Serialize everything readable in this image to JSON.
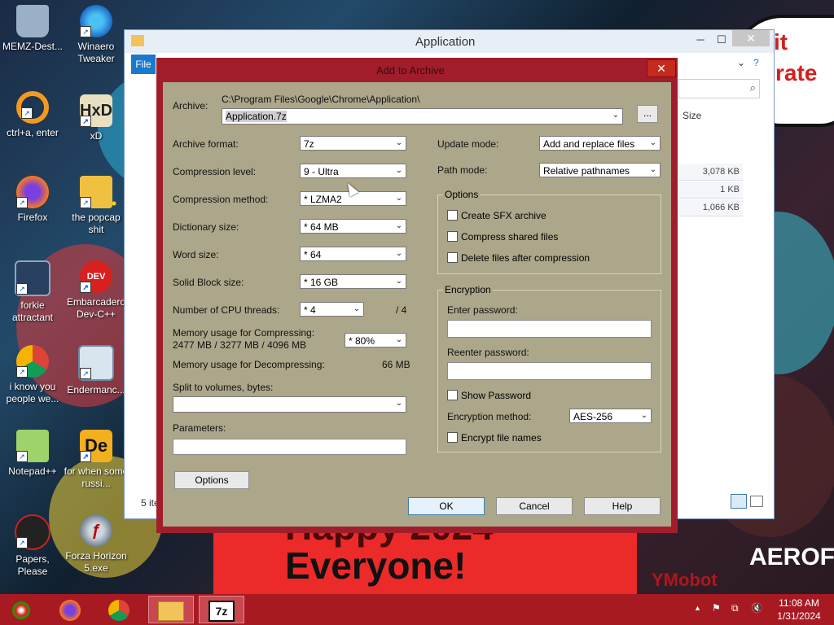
{
  "desktop": {
    "icons": [
      {
        "label": "MEMZ-Dest...",
        "icon": "recycle-bin-icon"
      },
      {
        "label": "Winaero Tweaker",
        "icon": "winaero-tweaker-icon"
      },
      {
        "label": "ctrl+a, enter",
        "icon": "orange-ring-icon"
      },
      {
        "label": "xD",
        "icon": "hxd-icon"
      },
      {
        "label": "Firefox",
        "icon": "firefox-icon"
      },
      {
        "label": "the popcap shit",
        "icon": "popcap-icon"
      },
      {
        "label": "forkie attractant",
        "icon": "monitor-gear-icon"
      },
      {
        "label": "Embarcadero Dev-C++",
        "icon": "devcpp-icon"
      },
      {
        "label": "i know you people we...",
        "icon": "chrome-icon"
      },
      {
        "label": "Endermanc...",
        "icon": "window-app-icon"
      },
      {
        "label": "Notepad++",
        "icon": "notepadpp-icon"
      },
      {
        "label": "for when some russi...",
        "icon": "de-icon"
      },
      {
        "label": "Papers, Please",
        "icon": "papers-please-icon"
      },
      {
        "label": "Forza Horizon 5.exe",
        "icon": "flash-icon"
      }
    ],
    "wallpaper_text": {
      "speech_line1": "it",
      "speech_line2": "rate",
      "banner_top": "Happy 2024",
      "banner": "Everyone!",
      "sign": "AEROFOS",
      "watermark": "YMobot"
    }
  },
  "explorer": {
    "title": "Application",
    "ribbon_file": "File",
    "column_size": "Size",
    "sizes": [
      "3,078 KB",
      "1 KB",
      "1,066 KB"
    ],
    "status_items": "5 ite",
    "search_icon": "search-icon"
  },
  "dialog": {
    "title": "Add to Archive",
    "archive_label": "Archive:",
    "archive_path": "C:\\Program Files\\Google\\Chrome\\Application\\",
    "archive_name": "Application.7z",
    "browse_label": "...",
    "left": {
      "archive_format_label": "Archive format:",
      "archive_format": "7z",
      "compression_level_label": "Compression level:",
      "compression_level": "9 - Ultra",
      "compression_method_label": "Compression method:",
      "compression_method": "* LZMA2",
      "dictionary_size_label": "Dictionary size:",
      "dictionary_size": "* 64 MB",
      "word_size_label": "Word size:",
      "word_size": "* 64",
      "solid_block_label": "Solid Block size:",
      "solid_block": "* 16 GB",
      "cpu_threads_label": "Number of CPU threads:",
      "cpu_threads": "* 4",
      "cpu_threads_max": "/ 4",
      "mem_compress_label": "Memory usage for Compressing:",
      "mem_compress_value": "2477 MB / 3277 MB / 4096 MB",
      "mem_compress_pct": "* 80%",
      "mem_decompress_label": "Memory usage for Decompressing:",
      "mem_decompress_value": "66 MB",
      "split_label": "Split to volumes, bytes:",
      "split_value": "",
      "parameters_label": "Parameters:",
      "parameters_value": "",
      "options_button": "Options"
    },
    "right": {
      "update_mode_label": "Update mode:",
      "update_mode": "Add and replace files",
      "path_mode_label": "Path mode:",
      "path_mode": "Relative pathnames",
      "options_group": "Options",
      "create_sfx": "Create SFX archive",
      "compress_shared": "Compress shared files",
      "delete_after": "Delete files after compression",
      "encryption_group": "Encryption",
      "enter_password_label": "Enter password:",
      "reenter_password_label": "Reenter password:",
      "show_password": "Show Password",
      "encryption_method_label": "Encryption method:",
      "encryption_method": "AES-256",
      "encrypt_names": "Encrypt file names"
    },
    "buttons": {
      "ok": "OK",
      "cancel": "Cancel",
      "help": "Help"
    }
  },
  "taskbar": {
    "pinned": [
      "firefox-icon",
      "chrome-icon",
      "file-explorer-icon",
      "7zip-icon"
    ],
    "time": "11:08 AM",
    "date": "1/31/2024"
  }
}
